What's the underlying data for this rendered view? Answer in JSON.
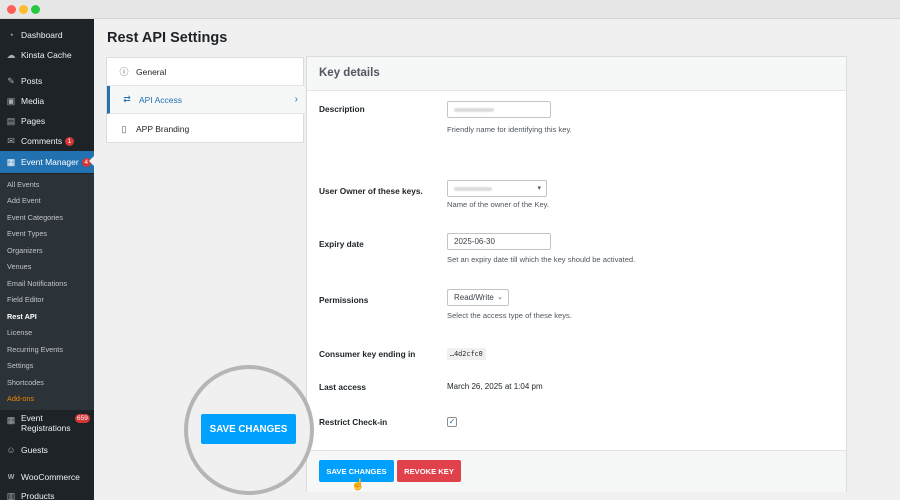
{
  "browser": {
    "dots": [
      "#ff5f57",
      "#febc2e",
      "#28c840"
    ]
  },
  "sidebar": {
    "menu": [
      {
        "label": "Dashboard",
        "icon": "dashboard-icon"
      },
      {
        "label": "Kinsta Cache",
        "icon": "kinsta-icon"
      },
      {
        "label": "Posts",
        "icon": "pin-icon"
      },
      {
        "label": "Media",
        "icon": "media-icon"
      },
      {
        "label": "Pages",
        "icon": "pages-icon"
      },
      {
        "label": "Comments",
        "icon": "comments-icon",
        "badge": "1"
      },
      {
        "label": "Event Manager",
        "icon": "calendar-icon",
        "badge": "4"
      },
      {
        "label": "Event Registrations",
        "label_line1": "Event",
        "label_line2": "Registrations",
        "icon": "registrations-icon",
        "badge": "659"
      },
      {
        "label": "Guests",
        "icon": "guests-icon"
      },
      {
        "label": "WooCommerce",
        "icon": "woocommerce-icon"
      },
      {
        "label": "Products",
        "icon": "products-icon"
      }
    ],
    "submenu": [
      "All Events",
      "Add Event",
      "Event Categories",
      "Event Types",
      "Organizers",
      "Venues",
      "Email Notifications",
      "Field Editor",
      "Rest API",
      "License",
      "Recurring Events",
      "Settings",
      "Shortcodes",
      "Add-ons"
    ],
    "accent": "#2271b1",
    "addon_color": "#f18500"
  },
  "page": {
    "title": "Rest API Settings"
  },
  "tabs": [
    {
      "label": "General",
      "icon": "info-icon"
    },
    {
      "label": "API Access",
      "icon": "swap-arrows-icon",
      "active": true
    },
    {
      "label": "APP Branding",
      "icon": "phone-icon"
    }
  ],
  "key_details": {
    "title": "Key details",
    "description": {
      "label": "Description",
      "help": "Friendly name for identifying this key."
    },
    "owner": {
      "label": "User Owner of these keys.",
      "help": "Name of the owner of the Key."
    },
    "expiry": {
      "label": "Expiry date",
      "value": "2025-06-30",
      "help": "Set an expiry date till which the key should be activated."
    },
    "permissions": {
      "label": "Permissions",
      "value": "Read/Write",
      "help": "Select the access type of these keys."
    },
    "consumer_key": {
      "label": "Consumer key ending in",
      "value": "…4d2cfc0"
    },
    "last_access": {
      "label": "Last access",
      "value": "March 26, 2025 at 1:04 pm"
    },
    "restrict_checkin": {
      "label": "Restrict Check-in",
      "checked": true
    }
  },
  "buttons": {
    "save": "SAVE CHANGES",
    "revoke": "REVOKE KEY",
    "save_color": "#00a0ff",
    "revoke_color": "#e0414b"
  },
  "callout": {
    "save": "SAVE CHANGES"
  }
}
